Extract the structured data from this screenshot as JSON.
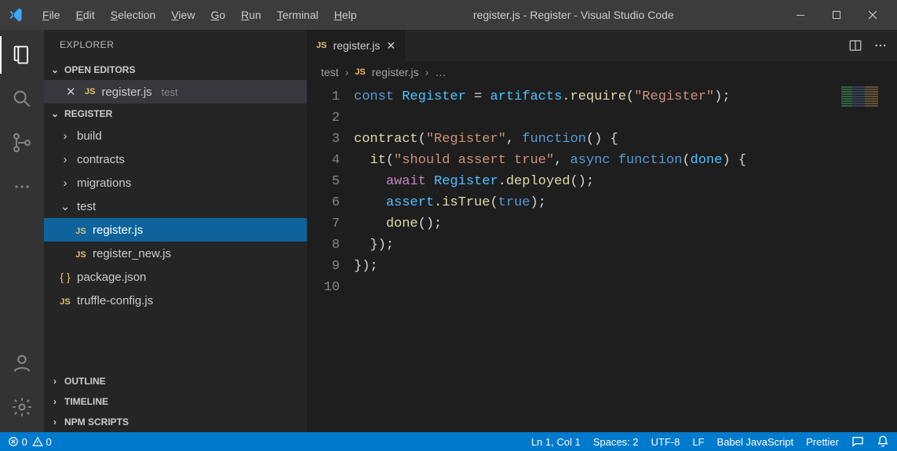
{
  "titlebar": {
    "menu": [
      "File",
      "Edit",
      "Selection",
      "View",
      "Go",
      "Run",
      "Terminal",
      "Help"
    ],
    "title": "register.js - Register - Visual Studio Code"
  },
  "sidebar": {
    "header": "EXPLORER",
    "open_editors_label": "OPEN EDITORS",
    "open_editor": {
      "filename": "register.js",
      "folder": "test"
    },
    "project_label": "REGISTER",
    "tree": {
      "folders": [
        "build",
        "contracts",
        "migrations"
      ],
      "open_folder": "test",
      "open_folder_files": [
        "register.js",
        "register_new.js"
      ],
      "root_files": [
        {
          "name": "package.json",
          "icon": "json"
        },
        {
          "name": "truffle-config.js",
          "icon": "js"
        }
      ]
    },
    "outline_label": "OUTLINE",
    "timeline_label": "TIMELINE",
    "npm_label": "NPM SCRIPTS"
  },
  "editor": {
    "tab": {
      "filename": "register.js"
    },
    "breadcrumb": {
      "folder": "test",
      "file": "register.js",
      "more": "…"
    },
    "code_lines": [
      [
        {
          "t": "const ",
          "c": "k-blue"
        },
        {
          "t": "Register",
          "c": "k-var"
        },
        {
          "t": " = "
        },
        {
          "t": "artifacts",
          "c": "k-var"
        },
        {
          "t": "."
        },
        {
          "t": "require",
          "c": "k-fn"
        },
        {
          "t": "("
        },
        {
          "t": "\"Register\"",
          "c": "k-str"
        },
        {
          "t": ");"
        }
      ],
      [],
      [
        {
          "t": "contract",
          "c": "k-fn"
        },
        {
          "t": "("
        },
        {
          "t": "\"Register\"",
          "c": "k-str"
        },
        {
          "t": ", "
        },
        {
          "t": "function",
          "c": "k-blue"
        },
        {
          "t": "() {"
        }
      ],
      [
        {
          "t": "  "
        },
        {
          "t": "it",
          "c": "k-fn"
        },
        {
          "t": "("
        },
        {
          "t": "\"should assert true\"",
          "c": "k-str"
        },
        {
          "t": ", "
        },
        {
          "t": "async ",
          "c": "k-blue"
        },
        {
          "t": "function",
          "c": "k-blue"
        },
        {
          "t": "("
        },
        {
          "t": "done",
          "c": "k-var"
        },
        {
          "t": ") {"
        }
      ],
      [
        {
          "t": "    "
        },
        {
          "t": "await ",
          "c": "k-kw"
        },
        {
          "t": "Register",
          "c": "k-var"
        },
        {
          "t": "."
        },
        {
          "t": "deployed",
          "c": "k-fn"
        },
        {
          "t": "();"
        }
      ],
      [
        {
          "t": "    "
        },
        {
          "t": "assert",
          "c": "k-var"
        },
        {
          "t": "."
        },
        {
          "t": "isTrue",
          "c": "k-fn"
        },
        {
          "t": "("
        },
        {
          "t": "true",
          "c": "k-const"
        },
        {
          "t": ");"
        }
      ],
      [
        {
          "t": "    "
        },
        {
          "t": "done",
          "c": "k-fn"
        },
        {
          "t": "();"
        }
      ],
      [
        {
          "t": "  });"
        }
      ],
      [
        {
          "t": "});"
        }
      ],
      []
    ]
  },
  "statusbar": {
    "errors": "0",
    "warnings": "0",
    "ln_col": "Ln 1, Col 1",
    "spaces": "Spaces: 2",
    "encoding": "UTF-8",
    "eol": "LF",
    "lang": "Babel JavaScript",
    "formatter": "Prettier"
  }
}
